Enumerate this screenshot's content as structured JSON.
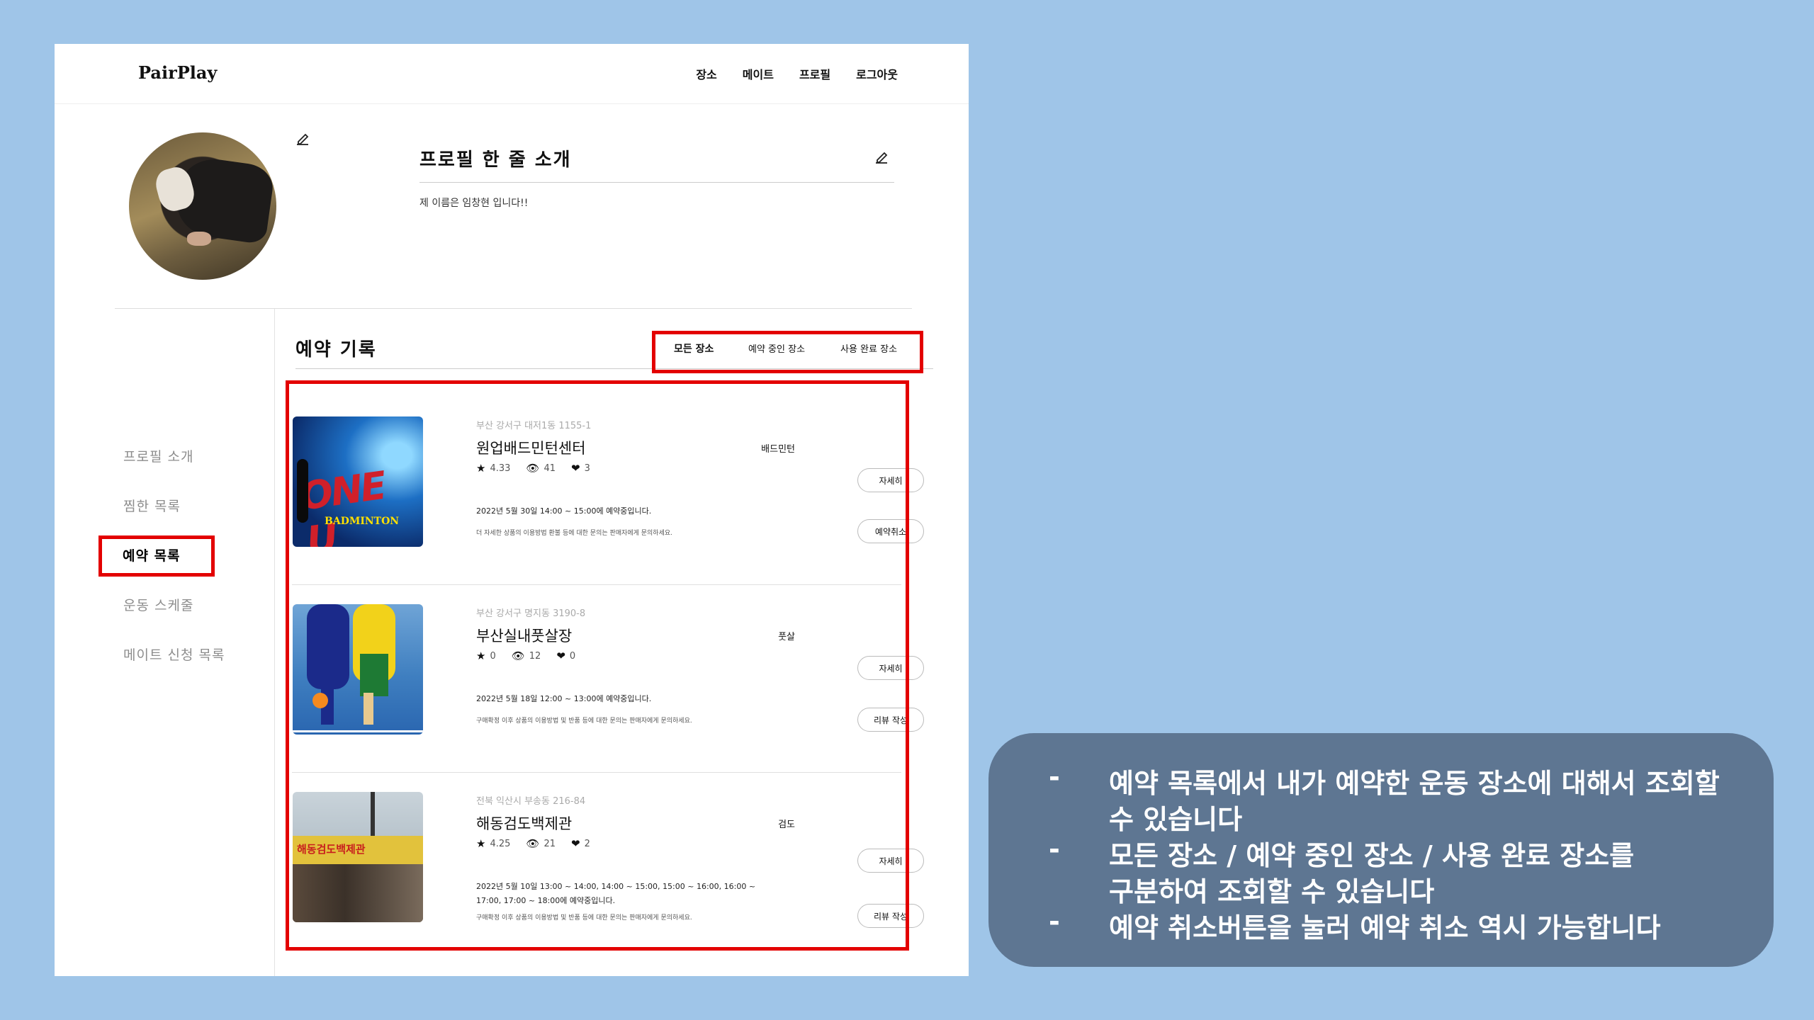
{
  "nav": {
    "logo": "PairPlay",
    "menu": [
      "장소",
      "메이트",
      "프로필",
      "로그아웃"
    ]
  },
  "profile": {
    "intro_title": "프로필 한 줄 소개",
    "intro_text": "제 이름은 임창현 입니다!!"
  },
  "sidebar": {
    "items": [
      "프로필 소개",
      "찜한 목록",
      "예약 목록",
      "운동 스케줄",
      "메이트 신청 목록"
    ],
    "active_index": 2
  },
  "reservations": {
    "title": "예약 기록",
    "tabs": [
      "모든 장소",
      "예약 중인 장소",
      "사용 완료 장소"
    ],
    "items": [
      {
        "address": "부산 강서구 대저1동 1155-1",
        "name": "원업배드민턴센터",
        "rating": "4.33",
        "views": "41",
        "likes": "3",
        "sport": "배드민턴",
        "time": "2022년 5월 30일 14:00 ~ 15:00에 예약중입니다.",
        "note": "더 자세한 상품의 이용방법 환불 등에 대한 문의는 판매자에게 문의하세요.",
        "detail_label": "자세히",
        "action_label": "예약취소",
        "thumb_text": "ONE U",
        "thumb_sub": "BADMINTON"
      },
      {
        "address": "부산 강서구 명지동 3190-8",
        "name": "부산실내풋살장",
        "rating": "0",
        "views": "12",
        "likes": "0",
        "sport": "풋살",
        "time": "2022년 5월 18일 12:00 ~ 13:00에 예약중입니다.",
        "note": "구매확정 이후 상품의 이용방법 및 반품 등에 대한 문의는 판매자에게 문의하세요.",
        "detail_label": "자세히",
        "action_label": "리뷰 작성"
      },
      {
        "address": "전북 익산시 부송동 216-84",
        "name": "해동검도백제관",
        "rating": "4.25",
        "views": "21",
        "likes": "2",
        "sport": "검도",
        "time": "2022년 5월 10일 13:00 ~ 14:00, 14:00 ~ 15:00, 15:00 ~ 16:00, 16:00 ~ 17:00, 17:00 ~ 18:00에 예약중입니다.",
        "note": "구매확정 이후 상품의 이용방법 및 반품 등에 대한 문의는 판매자에게 문의하세요.",
        "detail_label": "자세히",
        "action_label": "리뷰 작성",
        "thumb_text": "해동검도백제관"
      }
    ]
  },
  "callout": {
    "bullet": "-",
    "lines": [
      "예약 목록에서 내가 예약한 운동 장소에 대해서 조회할",
      "수 있습니다",
      "모든 장소 / 예약 중인 장소 / 사용 완료 장소를",
      "구분하여 조회할 수 있습니다",
      "예약 취소버튼을 눌러 예약 취소 역시 가능합니다"
    ]
  },
  "colors": {
    "background": "#9fc5e8",
    "highlight": "#e30000",
    "callout": "#5e7692"
  }
}
